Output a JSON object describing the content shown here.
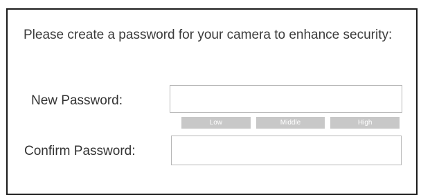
{
  "message": "Please create a password for your camera to enhance security:",
  "new_password": {
    "label": "New Password:",
    "value": ""
  },
  "strength_meter": {
    "levels": [
      "Low",
      "Middle",
      "High"
    ],
    "segment_color": "#c8c8c8"
  },
  "confirm_password": {
    "label": "Confirm Password:",
    "value": ""
  }
}
